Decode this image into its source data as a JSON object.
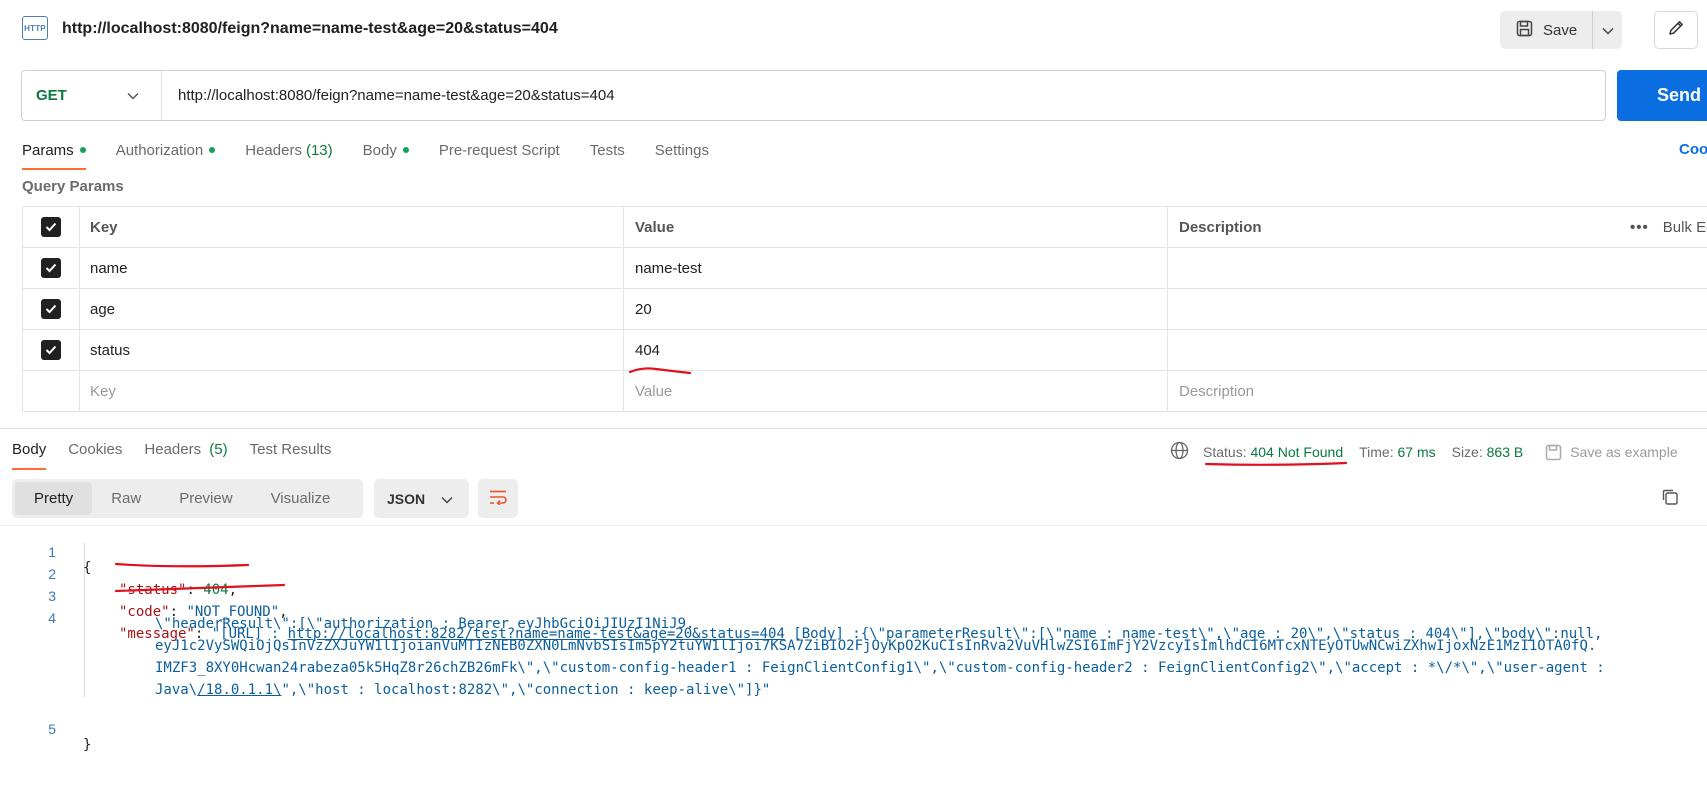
{
  "tab": {
    "icon": "HTTP",
    "title": "http://localhost:8080/feign?name=name-test&age=20&status=404"
  },
  "toolbar": {
    "save_label": "Save"
  },
  "request": {
    "method": "GET",
    "url": "http://localhost:8080/feign?name=name-test&age=20&status=404",
    "send_label": "Send"
  },
  "req_tabs": [
    {
      "label": "Params",
      "dot": true
    },
    {
      "label": "Authorization",
      "dot": true
    },
    {
      "label": "Headers",
      "count": "(13)"
    },
    {
      "label": "Body",
      "dot": true
    },
    {
      "label": "Pre-request Script"
    },
    {
      "label": "Tests"
    },
    {
      "label": "Settings"
    }
  ],
  "cookies_label": "Coo",
  "query_params": {
    "label": "Query Params",
    "headers": {
      "key": "Key",
      "value": "Value",
      "description": "Description",
      "bulk": "Bulk Edit"
    },
    "rows": [
      {
        "key": "name",
        "value": "name-test"
      },
      {
        "key": "age",
        "value": "20"
      },
      {
        "key": "status",
        "value": "404"
      }
    ],
    "placeholders": {
      "key": "Key",
      "value": "Value",
      "description": "Description"
    }
  },
  "res_tabs": [
    {
      "label": "Body"
    },
    {
      "label": "Cookies"
    },
    {
      "label": "Headers",
      "count": "(5)"
    },
    {
      "label": "Test Results"
    }
  ],
  "response_meta": {
    "status_label": "Status:",
    "status_value": "404 Not Found",
    "time_label": "Time:",
    "time_value": "67 ms",
    "size_label": "Size:",
    "size_value": "863 B",
    "save_example": "Save as example"
  },
  "view_modes": [
    "Pretty",
    "Raw",
    "Preview",
    "Visualize"
  ],
  "format": "JSON",
  "code": {
    "line_numbers": [
      "1",
      "2",
      "3",
      "4",
      "5"
    ],
    "open_brace": "{",
    "close_brace": "}",
    "status_key": "\"status\"",
    "status_value": "404",
    "code_key": "\"code\"",
    "code_value": "\"NOT_FOUND\"",
    "message_key": "\"message\"",
    "msg_prefix": "\"[URL] : ",
    "msg_url": "http://localhost:8282/test?name=name-test&age=20&status=404",
    "msg_line1_rest": " [Body] :{\\\"parameterResult\\\":[\\\"name : name-test\\\",\\\"age : 20\\\",\\\"status : 404\\\"],\\\"body\\\":null,",
    "msg_line2": "\\\"headerResult\\\":[\\\"authorization : Bearer eyJhbGciOiJIUzI1NiJ9.",
    "msg_line3": "eyJ1c2VySWQiOjQsInVzZXJuYW1lIjoianVuMTIzNEB0ZXN0LmNvbSIsIm5pY2tuYW1lIjoi7KSA7ZiBIO2FjOyKpO2KuCIsInRva2VuVHlwZSI6ImFjY2VzcyIsImlhdCI6MTcxNTEyOTUwNCwiZXhwIjoxNzE1MzI1OTA0fQ.",
    "msg_line4": "IMZF3_8XY0Hcwan24rabeza05k5HqZ8r26chZB26mFk\\\",\\\"custom-config-header1 : FeignClientConfig1\\\",\\\"custom-config-header2 : FeignClientConfig2\\\",\\\"accept : *\\/*\\\",\\\"user-agent :",
    "msg_line5_a": "Java\\",
    "msg_line5_link": "/18.0.1.1\\",
    "msg_line5_b": "\",\\\"host : localhost:8282\\\",\\\"connection : keep-alive\\\"]}\""
  },
  "colors": {
    "accent": "#ff6c37",
    "send": "#0b6ee0",
    "success": "#0b7a3e",
    "annotation": "#e0101e"
  }
}
